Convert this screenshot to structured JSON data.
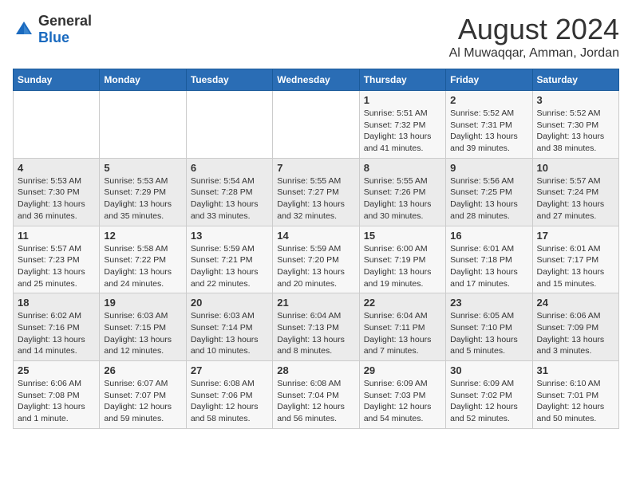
{
  "header": {
    "logo_general": "General",
    "logo_blue": "Blue",
    "month_title": "August 2024",
    "location": "Al Muwaqqar, Amman, Jordan"
  },
  "weekdays": [
    "Sunday",
    "Monday",
    "Tuesday",
    "Wednesday",
    "Thursday",
    "Friday",
    "Saturday"
  ],
  "weeks": [
    [
      {
        "day": "",
        "content": ""
      },
      {
        "day": "",
        "content": ""
      },
      {
        "day": "",
        "content": ""
      },
      {
        "day": "",
        "content": ""
      },
      {
        "day": "1",
        "content": "Sunrise: 5:51 AM\nSunset: 7:32 PM\nDaylight: 13 hours\nand 41 minutes."
      },
      {
        "day": "2",
        "content": "Sunrise: 5:52 AM\nSunset: 7:31 PM\nDaylight: 13 hours\nand 39 minutes."
      },
      {
        "day": "3",
        "content": "Sunrise: 5:52 AM\nSunset: 7:30 PM\nDaylight: 13 hours\nand 38 minutes."
      }
    ],
    [
      {
        "day": "4",
        "content": "Sunrise: 5:53 AM\nSunset: 7:30 PM\nDaylight: 13 hours\nand 36 minutes."
      },
      {
        "day": "5",
        "content": "Sunrise: 5:53 AM\nSunset: 7:29 PM\nDaylight: 13 hours\nand 35 minutes."
      },
      {
        "day": "6",
        "content": "Sunrise: 5:54 AM\nSunset: 7:28 PM\nDaylight: 13 hours\nand 33 minutes."
      },
      {
        "day": "7",
        "content": "Sunrise: 5:55 AM\nSunset: 7:27 PM\nDaylight: 13 hours\nand 32 minutes."
      },
      {
        "day": "8",
        "content": "Sunrise: 5:55 AM\nSunset: 7:26 PM\nDaylight: 13 hours\nand 30 minutes."
      },
      {
        "day": "9",
        "content": "Sunrise: 5:56 AM\nSunset: 7:25 PM\nDaylight: 13 hours\nand 28 minutes."
      },
      {
        "day": "10",
        "content": "Sunrise: 5:57 AM\nSunset: 7:24 PM\nDaylight: 13 hours\nand 27 minutes."
      }
    ],
    [
      {
        "day": "11",
        "content": "Sunrise: 5:57 AM\nSunset: 7:23 PM\nDaylight: 13 hours\nand 25 minutes."
      },
      {
        "day": "12",
        "content": "Sunrise: 5:58 AM\nSunset: 7:22 PM\nDaylight: 13 hours\nand 24 minutes."
      },
      {
        "day": "13",
        "content": "Sunrise: 5:59 AM\nSunset: 7:21 PM\nDaylight: 13 hours\nand 22 minutes."
      },
      {
        "day": "14",
        "content": "Sunrise: 5:59 AM\nSunset: 7:20 PM\nDaylight: 13 hours\nand 20 minutes."
      },
      {
        "day": "15",
        "content": "Sunrise: 6:00 AM\nSunset: 7:19 PM\nDaylight: 13 hours\nand 19 minutes."
      },
      {
        "day": "16",
        "content": "Sunrise: 6:01 AM\nSunset: 7:18 PM\nDaylight: 13 hours\nand 17 minutes."
      },
      {
        "day": "17",
        "content": "Sunrise: 6:01 AM\nSunset: 7:17 PM\nDaylight: 13 hours\nand 15 minutes."
      }
    ],
    [
      {
        "day": "18",
        "content": "Sunrise: 6:02 AM\nSunset: 7:16 PM\nDaylight: 13 hours\nand 14 minutes."
      },
      {
        "day": "19",
        "content": "Sunrise: 6:03 AM\nSunset: 7:15 PM\nDaylight: 13 hours\nand 12 minutes."
      },
      {
        "day": "20",
        "content": "Sunrise: 6:03 AM\nSunset: 7:14 PM\nDaylight: 13 hours\nand 10 minutes."
      },
      {
        "day": "21",
        "content": "Sunrise: 6:04 AM\nSunset: 7:13 PM\nDaylight: 13 hours\nand 8 minutes."
      },
      {
        "day": "22",
        "content": "Sunrise: 6:04 AM\nSunset: 7:11 PM\nDaylight: 13 hours\nand 7 minutes."
      },
      {
        "day": "23",
        "content": "Sunrise: 6:05 AM\nSunset: 7:10 PM\nDaylight: 13 hours\nand 5 minutes."
      },
      {
        "day": "24",
        "content": "Sunrise: 6:06 AM\nSunset: 7:09 PM\nDaylight: 13 hours\nand 3 minutes."
      }
    ],
    [
      {
        "day": "25",
        "content": "Sunrise: 6:06 AM\nSunset: 7:08 PM\nDaylight: 13 hours\nand 1 minute."
      },
      {
        "day": "26",
        "content": "Sunrise: 6:07 AM\nSunset: 7:07 PM\nDaylight: 12 hours\nand 59 minutes."
      },
      {
        "day": "27",
        "content": "Sunrise: 6:08 AM\nSunset: 7:06 PM\nDaylight: 12 hours\nand 58 minutes."
      },
      {
        "day": "28",
        "content": "Sunrise: 6:08 AM\nSunset: 7:04 PM\nDaylight: 12 hours\nand 56 minutes."
      },
      {
        "day": "29",
        "content": "Sunrise: 6:09 AM\nSunset: 7:03 PM\nDaylight: 12 hours\nand 54 minutes."
      },
      {
        "day": "30",
        "content": "Sunrise: 6:09 AM\nSunset: 7:02 PM\nDaylight: 12 hours\nand 52 minutes."
      },
      {
        "day": "31",
        "content": "Sunrise: 6:10 AM\nSunset: 7:01 PM\nDaylight: 12 hours\nand 50 minutes."
      }
    ]
  ]
}
